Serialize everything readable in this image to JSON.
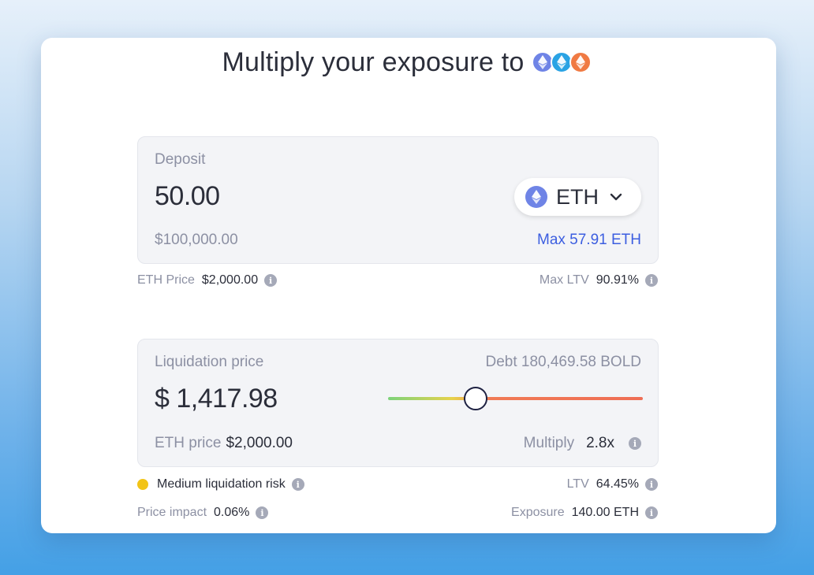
{
  "header": {
    "title": "Multiply your exposure to",
    "token_icons": [
      {
        "name": "eth-icon",
        "color": "#6f84e6"
      },
      {
        "name": "wsteth-icon",
        "color": "#2aa3e4"
      },
      {
        "name": "reth-icon",
        "color": "#f07a43"
      }
    ]
  },
  "deposit": {
    "label": "Deposit",
    "amount": "50.00",
    "usd_value": "$100,000.00",
    "token": "ETH",
    "max_label": "Max 57.91 ETH"
  },
  "deposit_info": {
    "price_label": "ETH Price",
    "price_value": "$2,000.00",
    "max_ltv_label": "Max LTV",
    "max_ltv_value": "90.91%"
  },
  "liquidation": {
    "label": "Liquidation price",
    "debt": "Debt 180,469.58 BOLD",
    "price": "$ 1,417.98",
    "eth_price_label": "ETH price",
    "eth_price_value": "$2,000.00",
    "multiply_label": "Multiply",
    "multiply_value": "2.8x",
    "slider_level": 0.345
  },
  "stats": {
    "risk_label": "Medium liquidation risk",
    "risk_color": "#f2c417",
    "ltv_label": "LTV",
    "ltv_value": "64.45%",
    "price_impact_label": "Price impact",
    "price_impact_value": "0.06%",
    "exposure_label": "Exposure",
    "exposure_value": "140.00 ETH"
  }
}
